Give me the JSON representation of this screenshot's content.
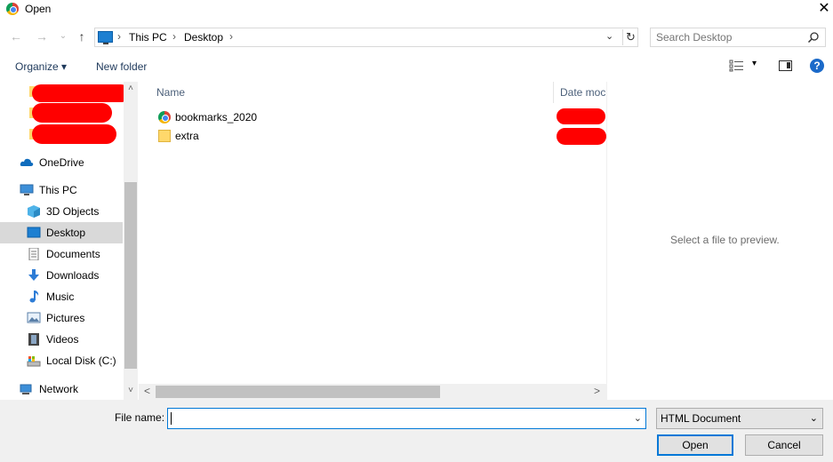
{
  "window": {
    "title": "Open",
    "close_glyph": "✕"
  },
  "nav": {
    "back_glyph": "←",
    "forward_glyph": "→",
    "recent_glyph": "⌄",
    "up_glyph": "↑",
    "breadcrumb": [
      "This PC",
      "Desktop"
    ],
    "crumb_sep": "›",
    "dropdown_glyph": "⌄",
    "refresh_glyph": "↻"
  },
  "search": {
    "placeholder": "Search Desktop"
  },
  "toolbar": {
    "organize_label": "Organize ▾",
    "new_folder_label": "New folder",
    "view_dd": "▾",
    "help_label": "?"
  },
  "sidebar": {
    "items": [
      {
        "label": "OneDrive"
      },
      {
        "label": "This PC"
      },
      {
        "label": "3D Objects"
      },
      {
        "label": "Desktop",
        "selected": true
      },
      {
        "label": "Documents"
      },
      {
        "label": "Downloads"
      },
      {
        "label": "Music"
      },
      {
        "label": "Pictures"
      },
      {
        "label": "Videos"
      },
      {
        "label": "Local Disk (C:)"
      },
      {
        "label": "Network"
      }
    ],
    "scroll_up": "˄",
    "scroll_down": "˅"
  },
  "filelist": {
    "columns": [
      "Name",
      "Date moc"
    ],
    "files": [
      {
        "name": "bookmarks_2020",
        "icon": "chrome-icon"
      },
      {
        "name": "extra",
        "icon": "folder-icon"
      }
    ],
    "scroll_left": "<",
    "scroll_right": ">"
  },
  "preview": {
    "text": "Select a file to preview."
  },
  "footer": {
    "filename_label": "File name:",
    "filename_value": "",
    "filetype_value": "HTML Document",
    "dd_glyph": "⌄",
    "open_label": "Open",
    "cancel_label": "Cancel"
  },
  "colors": {
    "accent": "#0078d7",
    "redaction": "#ff0000",
    "selected_bg": "#d9d9d9"
  }
}
